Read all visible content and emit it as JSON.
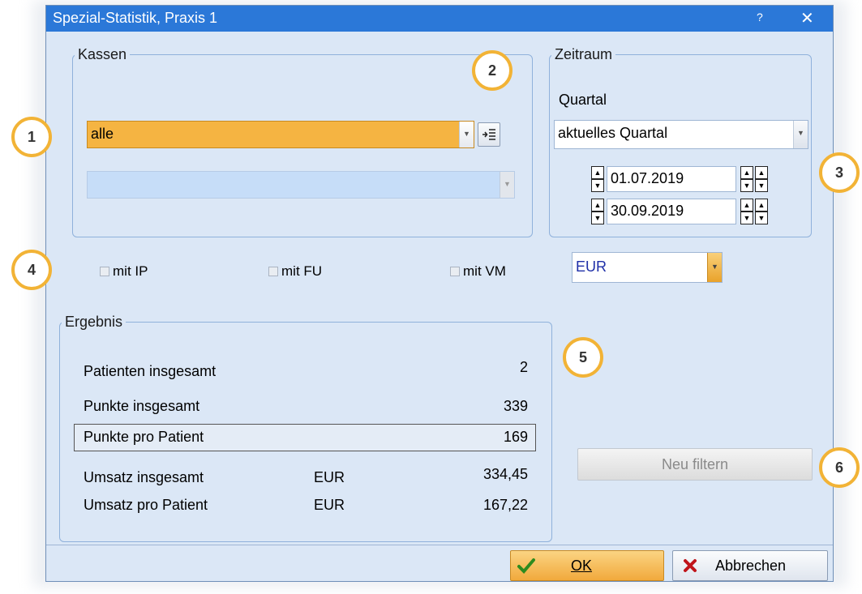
{
  "dialog": {
    "title": "Spezial-Statistik, Praxis 1",
    "help_label": "?",
    "close_label": "✕"
  },
  "kassen": {
    "legend": "Kassen",
    "selected": "alle",
    "second_value": ""
  },
  "zeitraum": {
    "legend": "Zeitraum",
    "quartal_label": "Quartal",
    "quartal_value": "aktuelles Quartal",
    "date_from": "01.07.2019",
    "date_to": "30.09.2019"
  },
  "options": {
    "ip_label": "mit IP",
    "fu_label": "mit FU",
    "vm_label": "mit VM",
    "currency": "EUR"
  },
  "ergebnis": {
    "legend": "Ergebnis",
    "rows": [
      {
        "label": "Patienten insgesamt",
        "unit": "",
        "value": "2"
      },
      {
        "label": "Punkte insgesamt",
        "unit": "",
        "value": "339"
      },
      {
        "label": "Punkte pro Patient",
        "unit": "",
        "value": "169"
      },
      {
        "label": "Umsatz insgesamt",
        "unit": "EUR",
        "value": "334,45"
      },
      {
        "label": "Umsatz pro Patient",
        "unit": "EUR",
        "value": "167,22"
      }
    ]
  },
  "buttons": {
    "neu_filtern": "Neu filtern",
    "ok": "OK",
    "abbrechen": "Abbrechen"
  },
  "callouts": [
    "1",
    "2",
    "3",
    "4",
    "5",
    "6"
  ],
  "colors": {
    "titlebar": "#2b78d8",
    "highlight": "#f5b442",
    "callout_border": "#f2b336",
    "currency_text": "#1f2fa8"
  }
}
